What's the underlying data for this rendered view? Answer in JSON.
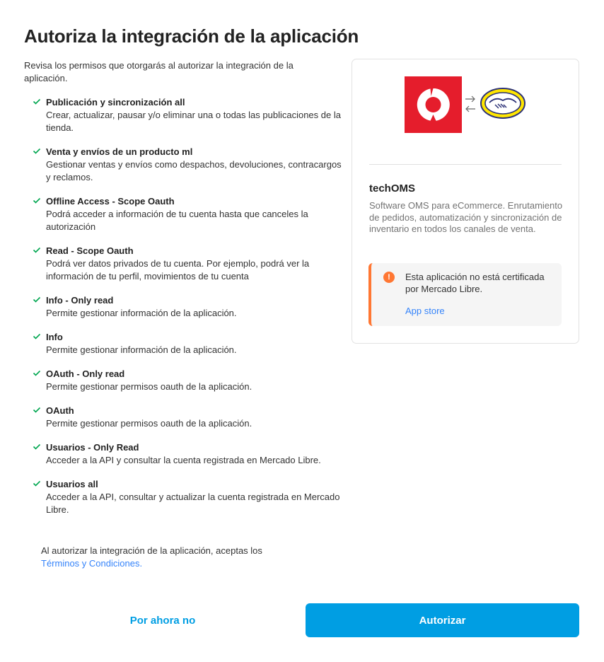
{
  "page": {
    "title": "Autoriza la integración de la aplicación",
    "intro": "Revisa los permisos que otorgarás al autorizar la integración de la aplicación."
  },
  "permissions": [
    {
      "title": "Publicación y sincronización all",
      "desc": "Crear, actualizar, pausar y/o eliminar una o todas las publicaciones de la tienda."
    },
    {
      "title": "Venta y envíos de un producto ml",
      "desc": "Gestionar ventas y envíos como despachos, devoluciones, contracargos y reclamos."
    },
    {
      "title": "Offline Access - Scope Oauth",
      "desc": "Podrá acceder a información de tu cuenta hasta que canceles la autorización"
    },
    {
      "title": "Read - Scope Oauth",
      "desc": "Podrá ver datos privados de tu cuenta. Por ejemplo, podrá ver la información de tu perfil, movimientos de tu cuenta"
    },
    {
      "title": "Info - Only read",
      "desc": "Permite gestionar información de la aplicación."
    },
    {
      "title": "Info",
      "desc": "Permite gestionar información de la aplicación."
    },
    {
      "title": "OAuth - Only read",
      "desc": "Permite gestionar permisos oauth de la aplicación."
    },
    {
      "title": "OAuth",
      "desc": "Permite gestionar permisos oauth de la aplicación."
    },
    {
      "title": "Usuarios - Only Read",
      "desc": "Acceder a la API y consultar la cuenta registrada en Mercado Libre."
    },
    {
      "title": "Usuarios all",
      "desc": "Acceder a la API, consultar y actualizar la cuenta registrada en Mercado Libre."
    }
  ],
  "terms": {
    "text": "Al autorizar la integración de la aplicación, aceptas los",
    "link": "Términos y Condiciones."
  },
  "actions": {
    "cancel_label": "Por ahora no",
    "authorize_label": "Autorizar"
  },
  "app": {
    "name": "techOMS",
    "description": "Software OMS para eCommerce. Enrutamiento de pedidos, automatización y sincronización de inventario en todos los canales de venta.",
    "warning_text": "Esta aplicación no está certificada por Mercado Libre.",
    "warning_link": "App store",
    "logo_icon": "techoms-logo",
    "partner_icon": "mercadolibre-handshake-logo"
  },
  "colors": {
    "primary": "#009ee3",
    "link": "#3483fa",
    "check": "#00a650",
    "warning": "#ff7733",
    "brand_red": "#e51d2c",
    "brand_yellow": "#ffe600"
  }
}
